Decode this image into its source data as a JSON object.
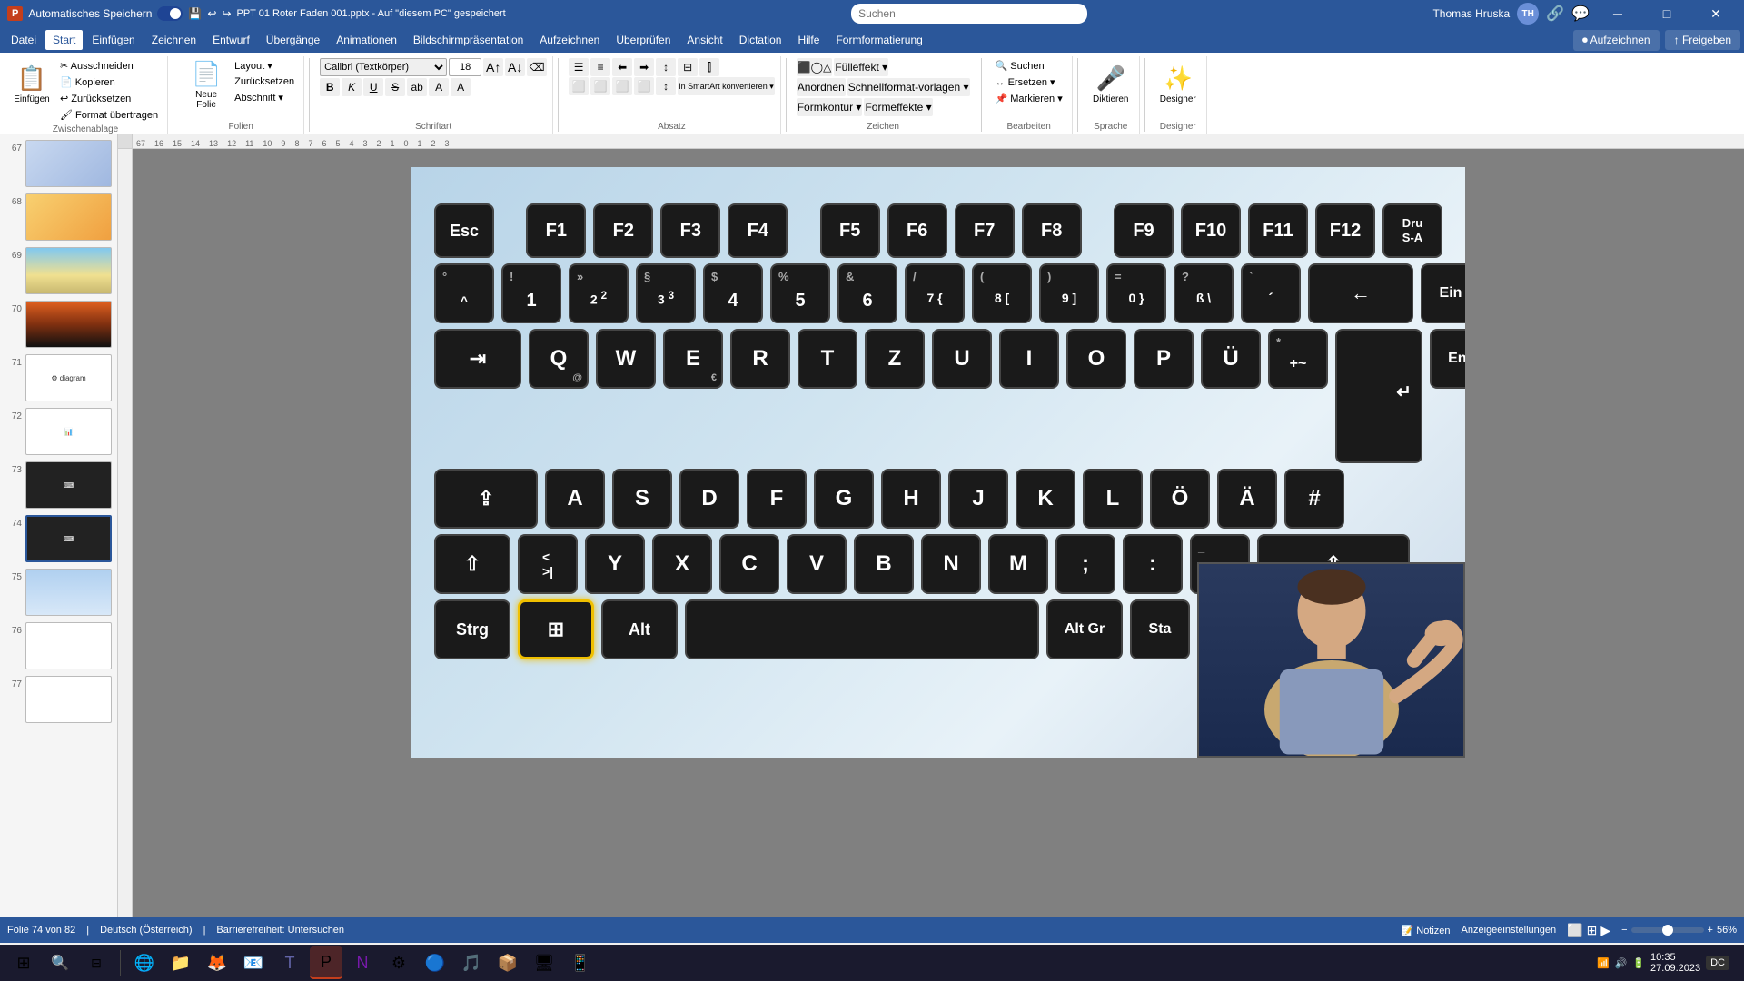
{
  "app": {
    "title": "PPT 01 Roter Faden 001.pptx - Auf \"diesem PC\" gespeichert",
    "autosave_label": "Automatisches Speichern",
    "user": "Thomas Hruska",
    "user_initials": "TH"
  },
  "titlebar": {
    "search_placeholder": "Suchen",
    "buttons": {
      "minimize": "─",
      "maximize": "□",
      "close": "✕"
    },
    "icons": [
      "💾",
      "↩",
      "↪",
      "🖼",
      "↓"
    ]
  },
  "menu": {
    "items": [
      "Datei",
      "Start",
      "Einfügen",
      "Zeichnen",
      "Entwurf",
      "Übergänge",
      "Animationen",
      "Bildschirmpräsentation",
      "Aufzeichnen",
      "Überprüfen",
      "Ansicht",
      "Dictation",
      "Hilfe",
      "Formformatierung"
    ]
  },
  "ribbon": {
    "groups": [
      {
        "label": "Zwischenablage",
        "buttons_large": [
          {
            "label": "Einfügen",
            "icon": "📋"
          }
        ],
        "buttons_small": [
          {
            "label": "Ausschneiden"
          },
          {
            "label": "Kopieren"
          },
          {
            "label": "Zurücksetzen"
          },
          {
            "label": "Format übertragen"
          }
        ]
      },
      {
        "label": "Folien",
        "buttons_large": [
          {
            "label": "Neue\nFolie",
            "icon": "📄"
          }
        ],
        "buttons_small": [
          {
            "label": "Layout ▾"
          },
          {
            "label": "Zurücksetzen"
          },
          {
            "label": "Abschnitt ▾"
          }
        ]
      },
      {
        "label": "Schriftart",
        "font_name": "Calibri (Textkörper)",
        "font_size": "18",
        "buttons": [
          "B",
          "K",
          "U",
          "S",
          "ab",
          "A",
          "A"
        ]
      },
      {
        "label": "Absatz",
        "buttons": [
          "list",
          "num-list",
          "indent-left",
          "indent-right",
          "align-left",
          "align-center",
          "align-right",
          "justify",
          "columns"
        ]
      },
      {
        "label": "Zeichen",
        "buttons": [
          "shapes",
          "fill",
          "outline",
          "effects"
        ]
      },
      {
        "label": "Bearbeiten",
        "buttons_small": [
          {
            "label": "Suchen"
          },
          {
            "label": "Ersetzen ▾"
          },
          {
            "label": "Markieren ▾"
          }
        ]
      },
      {
        "label": "Sprache",
        "buttons_large": [
          {
            "label": "Diktieren",
            "icon": "🎤"
          }
        ]
      },
      {
        "label": "Designer",
        "buttons_large": [
          {
            "label": "Designer",
            "icon": "✨"
          }
        ]
      }
    ]
  },
  "slides": [
    {
      "num": "67",
      "type": "gradient",
      "active": false
    },
    {
      "num": "68",
      "type": "yellow",
      "active": false
    },
    {
      "num": "69",
      "type": "beach",
      "active": false
    },
    {
      "num": "70",
      "type": "sunset",
      "active": false
    },
    {
      "num": "71",
      "type": "diagram",
      "active": false
    },
    {
      "num": "72",
      "type": "chart",
      "active": false
    },
    {
      "num": "73",
      "type": "keyboard-small",
      "active": false
    },
    {
      "num": "74",
      "type": "keyboard",
      "active": true
    },
    {
      "num": "75",
      "type": "sky",
      "active": false
    },
    {
      "num": "76",
      "type": "blank",
      "active": false
    },
    {
      "num": "77",
      "type": "blank",
      "active": false
    }
  ],
  "keyboard": {
    "rows": [
      {
        "keys": [
          {
            "label": "Esc",
            "width": "normal"
          },
          {
            "label": "F1",
            "width": "normal"
          },
          {
            "label": "F2",
            "width": "normal"
          },
          {
            "label": "F3",
            "width": "normal"
          },
          {
            "label": "F4",
            "width": "normal"
          },
          {
            "label": "",
            "width": "gap"
          },
          {
            "label": "F5",
            "width": "normal"
          },
          {
            "label": "F6",
            "width": "normal"
          },
          {
            "label": "F7",
            "width": "normal"
          },
          {
            "label": "F8",
            "width": "normal"
          },
          {
            "label": "",
            "width": "gap"
          },
          {
            "label": "F9",
            "width": "normal"
          },
          {
            "label": "F10",
            "width": "normal"
          },
          {
            "label": "F11",
            "width": "normal"
          },
          {
            "label": "F12",
            "width": "normal"
          },
          {
            "label": "Dru\nS-A",
            "width": "normal-partial"
          }
        ]
      },
      {
        "keys": [
          {
            "label": "°\n^",
            "top": "",
            "width": "normal"
          },
          {
            "label": "!\n1",
            "top": "!",
            "bottom": "1",
            "width": "normal"
          },
          {
            "label": "»\n2",
            "top": "»",
            "bottom": "2 ²",
            "width": "normal"
          },
          {
            "label": "§\n3",
            "top": "§",
            "bottom": "3 ³",
            "width": "normal"
          },
          {
            "label": "$\n4",
            "top": "$",
            "bottom": "4",
            "width": "normal"
          },
          {
            "label": "%\n5",
            "top": "%",
            "bottom": "5",
            "width": "normal"
          },
          {
            "label": "&\n6",
            "top": "&",
            "bottom": "6",
            "width": "normal"
          },
          {
            "label": "/\n7",
            "top": "/",
            "bottom": "7 {",
            "width": "normal"
          },
          {
            "label": "(\n8",
            "top": "(",
            "bottom": "8 [",
            "width": "normal"
          },
          {
            "label": ")\n9",
            "top": ")",
            "bottom": "9 ]",
            "width": "normal"
          },
          {
            "label": "=\n0",
            "top": "=",
            "bottom": "0 }",
            "width": "normal"
          },
          {
            "label": "?\nß",
            "top": "?",
            "bottom": "ß \\",
            "width": "normal"
          },
          {
            "label": "`\n´",
            "top": "`",
            "bottom": "´",
            "width": "normal"
          },
          {
            "label": "←",
            "width": "wide"
          },
          {
            "label": "Ein",
            "width": "normal-partial"
          }
        ]
      },
      {
        "keys": [
          {
            "label": "⇥",
            "width": "wide"
          },
          {
            "label": "Q",
            "sub": "@",
            "width": "normal"
          },
          {
            "label": "W",
            "width": "normal"
          },
          {
            "label": "E",
            "sub": "€",
            "width": "normal"
          },
          {
            "label": "R",
            "width": "normal"
          },
          {
            "label": "T",
            "width": "normal"
          },
          {
            "label": "Z",
            "width": "normal"
          },
          {
            "label": "U",
            "width": "normal"
          },
          {
            "label": "I",
            "width": "normal"
          },
          {
            "label": "O",
            "width": "normal"
          },
          {
            "label": "P",
            "width": "normal"
          },
          {
            "label": "Ü",
            "width": "normal"
          },
          {
            "label": "+\n~",
            "width": "normal"
          },
          {
            "label": "↵",
            "width": "enter"
          },
          {
            "label": "Ent",
            "width": "normal-partial"
          }
        ]
      },
      {
        "keys": [
          {
            "label": "⇪",
            "width": "wide"
          },
          {
            "label": "A",
            "width": "normal"
          },
          {
            "label": "S",
            "width": "normal"
          },
          {
            "label": "D",
            "width": "normal"
          },
          {
            "label": "F",
            "width": "normal"
          },
          {
            "label": "G",
            "width": "normal"
          },
          {
            "label": "H",
            "width": "normal"
          },
          {
            "label": "J",
            "width": "normal"
          },
          {
            "label": "K",
            "width": "normal"
          },
          {
            "label": "L",
            "width": "normal"
          },
          {
            "label": "Ö",
            "width": "normal"
          },
          {
            "label": "Ä",
            "width": "normal"
          },
          {
            "label": "#",
            "width": "normal"
          }
        ]
      },
      {
        "keys": [
          {
            "label": "⇧",
            "width": "normal"
          },
          {
            "label": "<\n>|",
            "width": "normal"
          },
          {
            "label": "Y",
            "width": "normal"
          },
          {
            "label": "X",
            "width": "normal"
          },
          {
            "label": "C",
            "width": "normal"
          },
          {
            "label": "V",
            "width": "normal"
          },
          {
            "label": "B",
            "width": "normal"
          },
          {
            "label": "N",
            "width": "normal"
          },
          {
            "label": "M",
            "width": "normal"
          },
          {
            "label": ";",
            "width": "normal"
          },
          {
            "label": ":",
            "width": "normal"
          },
          {
            "label": "_\n-",
            "width": "normal"
          },
          {
            "label": "⇧",
            "width": "wide"
          }
        ]
      },
      {
        "keys": [
          {
            "label": "Strg",
            "width": "normal"
          },
          {
            "label": "⊞",
            "width": "normal",
            "selected": true
          },
          {
            "label": "Alt",
            "width": "normal"
          },
          {
            "label": "",
            "width": "space"
          },
          {
            "label": "Alt Gr",
            "width": "normal"
          },
          {
            "label": "Sta",
            "width": "normal-partial"
          }
        ]
      }
    ]
  },
  "statusbar": {
    "slide_info": "Folie 74 von 82",
    "language": "Deutsch (Österreich)",
    "accessibility": "Barrierefreiheit: Untersuchen",
    "notes": "Notizen",
    "view_settings": "Anzeigeeinstellungen"
  },
  "taskbar": {
    "items": [
      "⊞",
      "💬",
      "🔍",
      "📁",
      "🦊",
      "🌐",
      "⚙️",
      "📧",
      "🐧",
      "📑",
      "🎨",
      "📝",
      "🔵",
      "🎵",
      "📦",
      "🖥️",
      "DC"
    ]
  }
}
